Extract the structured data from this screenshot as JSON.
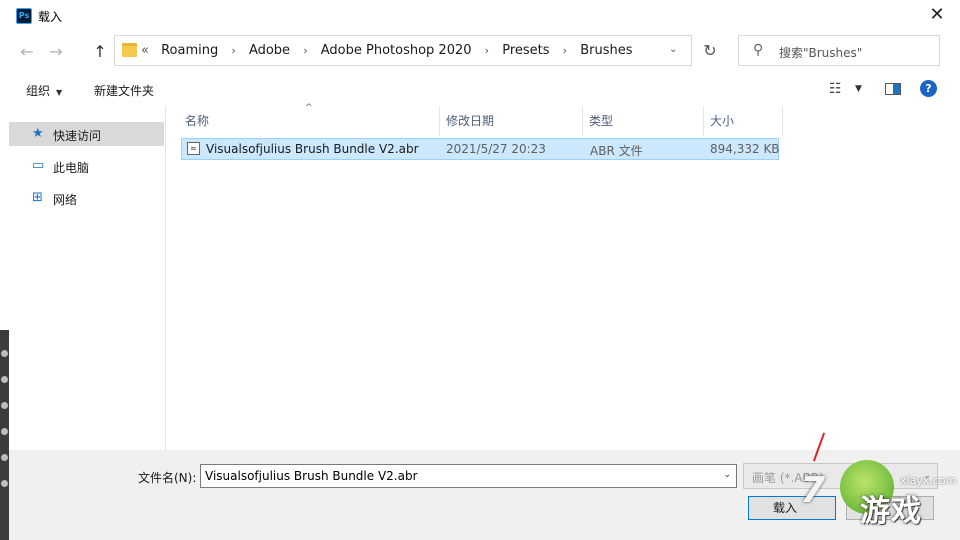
{
  "window": {
    "app_icon_label": "Ps",
    "title": "载入",
    "close_glyph": "✕"
  },
  "nav": {
    "back_glyph": "←",
    "forward_glyph": "→",
    "up_glyph": "↑"
  },
  "address": {
    "overflow": "«",
    "crumbs": [
      "Roaming",
      "Adobe",
      "Adobe Photoshop 2020",
      "Presets",
      "Brushes"
    ],
    "separator": "›",
    "dropdown_glyph": "⌄",
    "refresh_glyph": "↻"
  },
  "search": {
    "placeholder": "搜索\"Brushes\"",
    "icon": "search-icon"
  },
  "toolbar": {
    "organize_label": "组织",
    "new_folder_label": "新建文件夹",
    "caret": "▼",
    "help_label": "?"
  },
  "sidebar": {
    "items": [
      {
        "label": "快速访问",
        "icon": "star-icon",
        "glyph": "★",
        "color": "#1a73c9",
        "selected": true
      },
      {
        "label": "此电脑",
        "icon": "computer-icon",
        "glyph": "🖥",
        "color": "#1a73c9",
        "selected": false
      },
      {
        "label": "网络",
        "icon": "network-icon",
        "glyph": "🖧",
        "color": "#1a73c9",
        "selected": false
      }
    ]
  },
  "columns": {
    "name": "名称",
    "modified": "修改日期",
    "type": "类型",
    "size": "大小",
    "sort_glyph": "^"
  },
  "files": [
    {
      "name": "Visualsofjulius Brush Bundle V2.abr",
      "modified": "2021/5/27 20:23",
      "type": "ABR 文件",
      "size": "894,332 KB",
      "icon": "brush-file-icon",
      "icon_glyph": "≈",
      "selected": true
    }
  ],
  "footer": {
    "filename_label": "文件名(N):",
    "filename_value": "Visualsofjulius Brush Bundle V2.abr",
    "filter_text": "画笔 (*.ABR)",
    "load_label": "载入",
    "cancel_label": "",
    "dropdown_glyph": "⌄"
  },
  "watermark": {
    "numeral": "7",
    "brand": "游戏",
    "site": "xlayx.com"
  },
  "colors": {
    "selection_bg": "#cce8ff",
    "selection_border": "#99d1ff",
    "accent": "#0078d7",
    "header_text": "#4c607a"
  }
}
